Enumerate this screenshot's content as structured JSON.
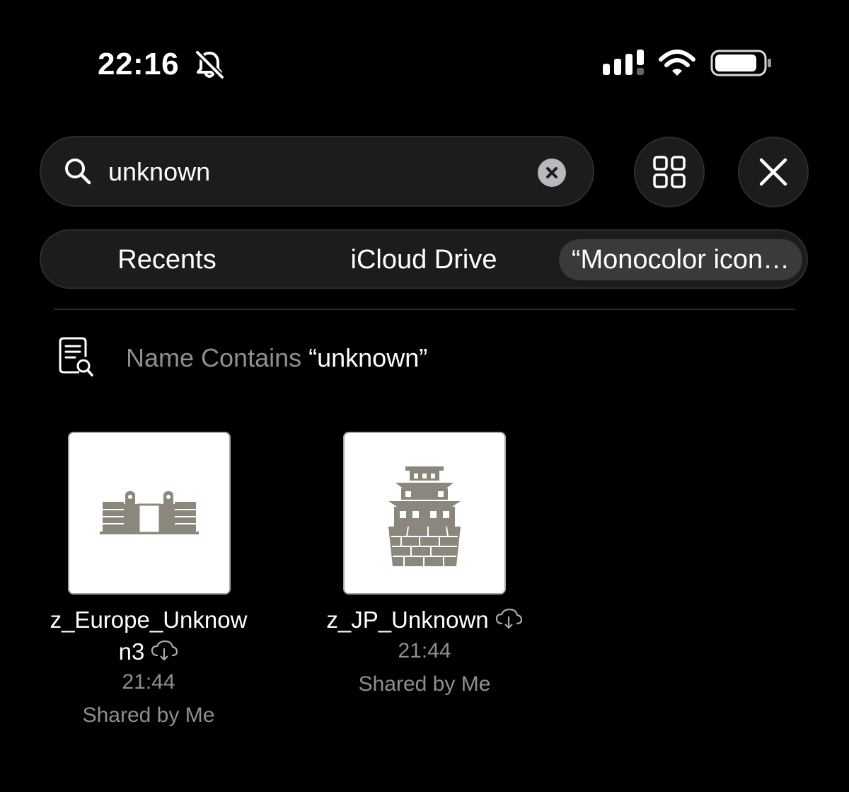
{
  "status_bar": {
    "time": "22:16",
    "icons": [
      "bell-slash-icon",
      "cellular-signal-icon",
      "wifi-icon",
      "battery-icon"
    ]
  },
  "search": {
    "value": "unknown",
    "icons": [
      "search-icon",
      "clear-icon"
    ]
  },
  "toolbar": {
    "icons": [
      "grid-view-icon",
      "close-icon"
    ]
  },
  "scopes": {
    "items": [
      "Recents",
      "iCloud Drive",
      "“Monocolor icon…"
    ],
    "selected": 2
  },
  "suggestion": {
    "prefix": "Name Contains ",
    "term": "“unknown”",
    "icon": "document-search-icon"
  },
  "files": [
    {
      "name_line1": "z_Europe_Unknow",
      "name_line2": "n3",
      "time": "21:44",
      "sharing": "Shared by Me",
      "icon": "cloud-download-icon",
      "thumbnail": "european-gate-icon"
    },
    {
      "name": "z_JP_Unknown",
      "time": "21:44",
      "sharing": "Shared by Me",
      "icon": "cloud-download-icon",
      "thumbnail": "japanese-castle-icon"
    }
  ],
  "colors": {
    "background": "#000000",
    "surface": "#1c1c1e",
    "selected": "#3a3a3c",
    "secondary_text": "#8e8e93",
    "thumbnail_fill": "#8c877c"
  }
}
